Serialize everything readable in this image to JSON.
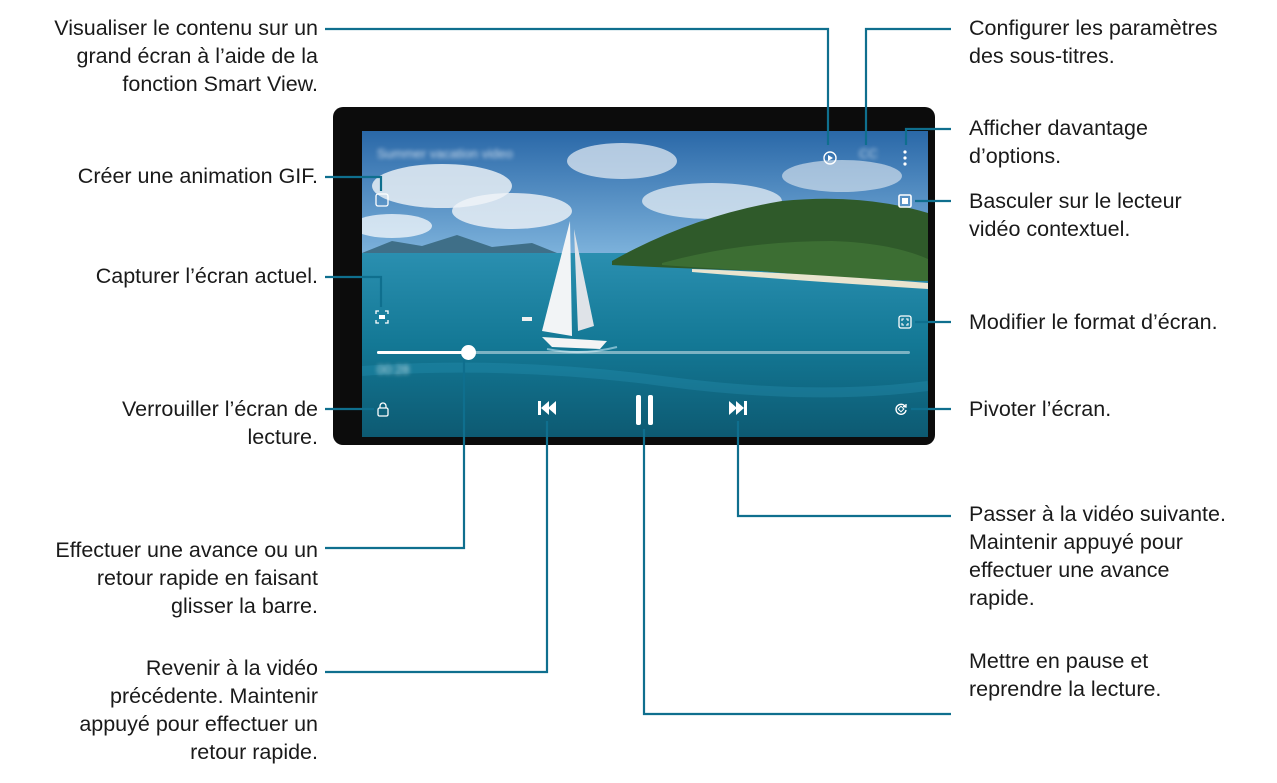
{
  "callouts": {
    "smart_view": "Visualiser le contenu sur un\ngrand écran à l’aide de la\nfonction Smart View.",
    "gif": "Créer une animation GIF.",
    "capture": "Capturer l’écran actuel.",
    "lock": "Verrouiller l’écran de\nlecture.",
    "seek": "Effectuer une avance ou un\nretour rapide en faisant\nglisser la barre.",
    "previous": "Revenir à la vidéo\nprécédente. Maintenir\nappuyé pour effectuer un\nretour rapide.",
    "subtitles": "Configurer les paramètres\ndes sous-titres.",
    "more_options": "Afficher davantage\nd’options.",
    "popup_player": "Basculer sur le lecteur\nvidéo contextuel.",
    "screen_ratio": "Modifier le format d’écran.",
    "rotate": "Pivoter l’écran.",
    "next": "Passer à la vidéo suivante.\nMaintenir appuyé pour\neffectuer une avance\nrapide.",
    "pause": "Mettre en pause et\nreprendre la lecture."
  },
  "player": {
    "video_title": "Summer vacation video",
    "subtitle_label": "CC",
    "current_time": "00:28",
    "progress": 0.17
  },
  "icons": {
    "smart_view": "smart-view-icon",
    "subtitles": "subtitles-icon",
    "more": "more-options-icon",
    "gif": "gif-icon",
    "popup": "popup-player-icon",
    "capture": "capture-icon",
    "ratio": "screen-ratio-icon",
    "lock": "lock-icon",
    "previous": "previous-icon",
    "pause": "pause-icon",
    "next": "next-icon",
    "rotate": "rotate-icon"
  },
  "colors": {
    "leader": "#0f6f8e",
    "text": "#1a1a1a"
  }
}
